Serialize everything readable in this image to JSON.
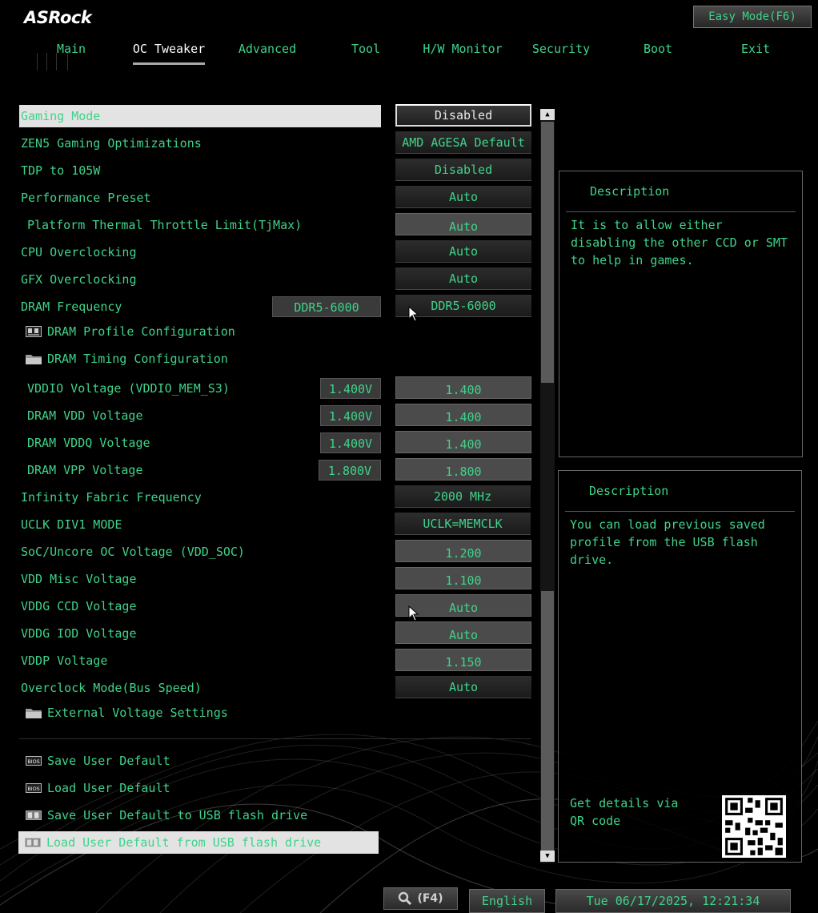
{
  "brand": {
    "logo": "ASRock"
  },
  "header": {
    "easy_mode_label": "Easy Mode(F6)"
  },
  "tabs": [
    {
      "label": "Main"
    },
    {
      "label": "OC Tweaker"
    },
    {
      "label": "Advanced"
    },
    {
      "label": "Tool"
    },
    {
      "label": "H/W Monitor"
    },
    {
      "label": "Security"
    },
    {
      "label": "Boot"
    },
    {
      "label": "Exit"
    }
  ],
  "active_tab": "OC Tweaker",
  "settings": {
    "gaming_mode": {
      "label": "Gaming Mode",
      "value": "Disabled"
    },
    "zen5": {
      "label": "ZEN5 Gaming Optimizations",
      "value": "AMD AGESA Default"
    },
    "tdp": {
      "label": "TDP to 105W",
      "value": "Disabled"
    },
    "perf_preset": {
      "label": "Performance Preset",
      "value": "Auto"
    },
    "tjmax": {
      "label": "Platform Thermal Throttle Limit(TjMax)",
      "value": "Auto"
    },
    "cpu_oc": {
      "label": "CPU Overclocking",
      "value": "Auto"
    },
    "gfx_oc": {
      "label": "GFX Overclocking",
      "value": "Auto"
    },
    "dram_freq": {
      "label": "DRAM Frequency",
      "current": "DDR5-6000",
      "value": "DDR5-6000"
    },
    "dram_profile": {
      "label": "DRAM Profile Configuration"
    },
    "dram_timing": {
      "label": "DRAM Timing Configuration"
    },
    "vddio": {
      "label": "VDDIO Voltage (VDDIO_MEM_S3)",
      "current": "1.400V",
      "value": "1.400"
    },
    "dram_vdd": {
      "label": "DRAM VDD Voltage",
      "current": "1.400V",
      "value": "1.400"
    },
    "dram_vddq": {
      "label": "DRAM VDDQ Voltage",
      "current": "1.400V",
      "value": "1.400"
    },
    "dram_vpp": {
      "label": "DRAM VPP Voltage",
      "current": "1.800V",
      "value": "1.800"
    },
    "if_freq": {
      "label": "Infinity Fabric Frequency",
      "value": "2000 MHz"
    },
    "uclk": {
      "label": "UCLK DIV1 MODE",
      "value": "UCLK=MEMCLK"
    },
    "soc_v": {
      "label": "SoC/Uncore OC Voltage (VDD_SOC)",
      "value": "1.200"
    },
    "vdd_misc": {
      "label": "VDD Misc Voltage",
      "value": "1.100"
    },
    "vddg_ccd": {
      "label": "VDDG CCD Voltage",
      "value": "Auto"
    },
    "vddg_iod": {
      "label": "VDDG IOD Voltage",
      "value": "Auto"
    },
    "vddp": {
      "label": "VDDP Voltage",
      "value": "1.150"
    },
    "oc_mode": {
      "label": "Overclock Mode(Bus Speed)",
      "value": "Auto"
    },
    "ext_voltage": {
      "label": "External Voltage Settings"
    },
    "save_default": {
      "label": "Save User Default"
    },
    "load_default": {
      "label": "Load User Default"
    },
    "save_usb": {
      "label": "Save User Default to USB flash drive"
    },
    "load_usb": {
      "label": "Load User Default from USB flash drive"
    }
  },
  "description_top": {
    "title": "Description",
    "text": "It is to allow either disabling the other CCD or SMT to help in games."
  },
  "description_bottom": {
    "title": "Description",
    "text": "You can load previous saved profile from the USB flash drive.",
    "qr_text": "Get details via QR code"
  },
  "footer": {
    "search_key": "(F4)",
    "language": "English",
    "datetime": "Tue 06/17/2025, 12:21:34"
  },
  "colors": {
    "accent": "#3fd38a",
    "highlight": "#e3e3e3",
    "background": "#000000"
  },
  "icons": [
    "search-icon",
    "folder-icon",
    "profile-icon",
    "bios-chip-icon",
    "usb-drive-icon",
    "qr-code-icon",
    "mouse-cursor-icon",
    "scroll-up-arrow-icon",
    "scroll-down-arrow-icon"
  ]
}
